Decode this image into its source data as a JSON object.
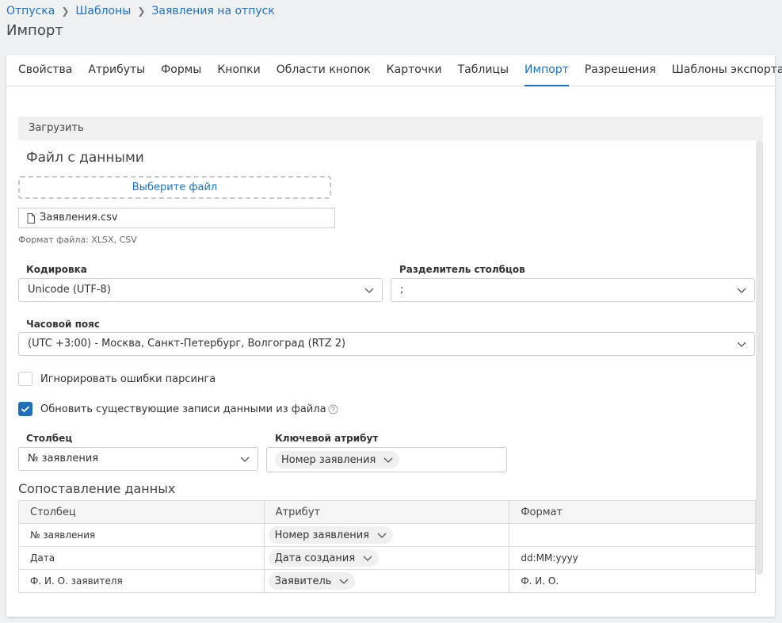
{
  "breadcrumb": [
    "Отпуска",
    "Шаблоны",
    "Заявления на отпуск"
  ],
  "page_title": "Импорт",
  "tabs": [
    {
      "label": "Свойства"
    },
    {
      "label": "Атрибуты"
    },
    {
      "label": "Формы"
    },
    {
      "label": "Кнопки"
    },
    {
      "label": "Области кнопок"
    },
    {
      "label": "Карточки"
    },
    {
      "label": "Таблицы"
    },
    {
      "label": "Импорт",
      "active": true
    },
    {
      "label": "Разрешения"
    },
    {
      "label": "Шаблоны экспорта"
    }
  ],
  "upload": {
    "header": "Загрузить",
    "file_title": "Файл с данными",
    "choose_label": "Выберите файл",
    "file_name": "Заявления.csv",
    "file_hint": "Формат файла: XLSX, CSV"
  },
  "encoding": {
    "label": "Кодировка",
    "value": "Unicode (UTF-8)"
  },
  "separator": {
    "label": "Разделитель столбцов",
    "value": ";"
  },
  "timezone": {
    "label": "Часовой пояс",
    "value": "(UTC +3:00) - Москва, Санкт-Петербург, Волгоград (RTZ 2)"
  },
  "ignore_errors": {
    "label": "Игнорировать ошибки парсинга",
    "checked": false
  },
  "update_records": {
    "label": "Обновить существующие записи данными из файла",
    "checked": true
  },
  "column": {
    "label": "Столбец",
    "value": "№ заявления"
  },
  "key_attr": {
    "label": "Ключевой атрибут",
    "value": "Номер заявления"
  },
  "mapping": {
    "title": "Сопоставление данных",
    "headers": [
      "Столбец",
      "Атрибут",
      "Формат"
    ],
    "rows": [
      {
        "column": "№ заявления",
        "attribute": "Номер заявления",
        "format": ""
      },
      {
        "column": "Дата",
        "attribute": "Дата создания",
        "format": "dd:MM:yyyy"
      },
      {
        "column": "Ф. И. О. заявителя",
        "attribute": "Заявитель",
        "format": "Ф. И. О."
      }
    ]
  },
  "colors": {
    "accent": "#1f6fb8"
  }
}
